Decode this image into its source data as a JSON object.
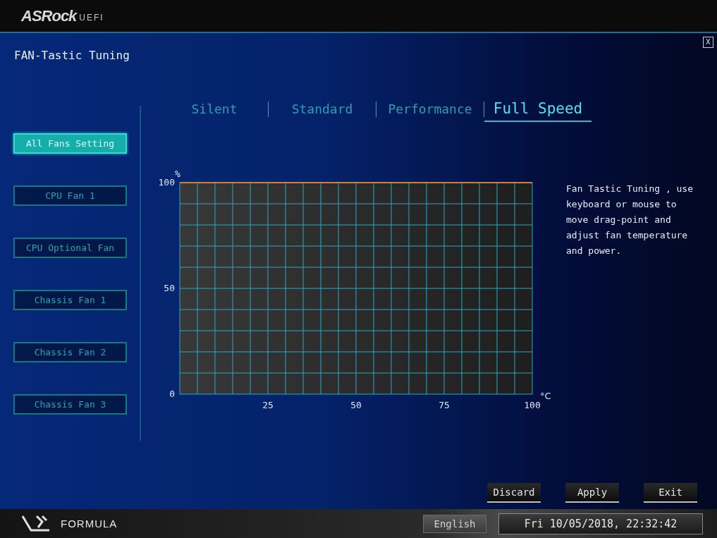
{
  "logo": {
    "brand": "ASRock",
    "suffix": "UEFI"
  },
  "page_title": "FAN-Tastic Tuning",
  "close_button": "X",
  "tabs": [
    {
      "label": "Silent",
      "selected": false
    },
    {
      "label": "Standard",
      "selected": false
    },
    {
      "label": "Performance",
      "selected": false
    },
    {
      "label": "Full Speed",
      "selected": true
    }
  ],
  "fans": [
    {
      "label": "All Fans Setting",
      "selected": true
    },
    {
      "label": "CPU Fan 1",
      "selected": false
    },
    {
      "label": "CPU Optional Fan",
      "selected": false
    },
    {
      "label": "Chassis Fan 1",
      "selected": false
    },
    {
      "label": "Chassis Fan 2",
      "selected": false
    },
    {
      "label": "Chassis Fan 3",
      "selected": false
    }
  ],
  "chart_data": {
    "type": "line",
    "xlabel": "°C",
    "ylabel": "%",
    "x": [
      0,
      100
    ],
    "grid": true,
    "series": [
      {
        "color": "#c8843c",
        "values": [
          100,
          100
        ]
      }
    ],
    "xlim": [
      0,
      100
    ],
    "ylim": [
      0,
      100
    ],
    "xticks": [
      25,
      50,
      75,
      100
    ],
    "yticks": [
      0,
      50,
      100
    ]
  },
  "help_text": "Fan Tastic Tuning , use keyboard or mouse to move drag-point and adjust fan temperature and power.",
  "buttons": [
    "Discard",
    "Apply",
    "Exit"
  ],
  "footer": {
    "brand": "FORMULA",
    "language": "English",
    "datetime": "Fri 10/05/2018, 22:32:42"
  }
}
